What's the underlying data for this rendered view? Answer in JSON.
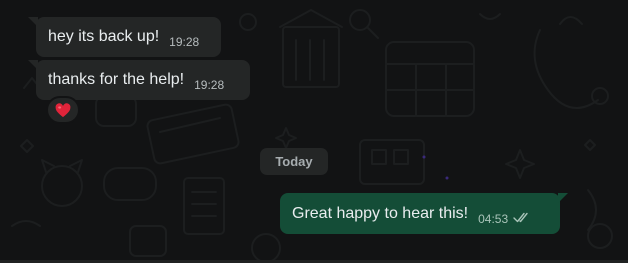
{
  "chat": {
    "messages_in": [
      {
        "text": "hey its back up!",
        "time": "19:28"
      },
      {
        "text": "thanks for the help!",
        "time": "19:28",
        "reaction": "heart-emoji"
      }
    ],
    "date_separator": "Today",
    "messages_out": [
      {
        "text": "Great happy to hear this!",
        "time": "04:53",
        "status": "read-double-check"
      }
    ]
  },
  "colors": {
    "background": "#121314",
    "incoming_bubble": "#242626",
    "outgoing_bubble": "#144d37",
    "text_primary": "#e9edef",
    "reaction_heart": "#e0243a"
  }
}
